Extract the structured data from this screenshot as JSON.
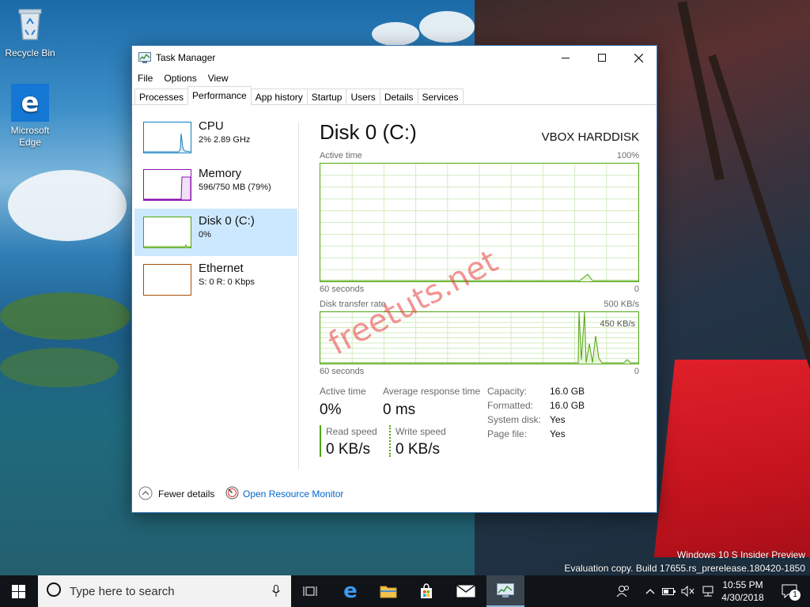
{
  "desktop": {
    "icons": [
      {
        "label": "Recycle Bin",
        "icon": "recycle-bin-icon"
      },
      {
        "label": "Microsoft Edge",
        "icon": "edge-icon"
      }
    ],
    "watermark_line1": "Windows 10 S Insider Preview",
    "watermark_line2": "Evaluation copy. Build 17655.rs_prerelease.180420-1850",
    "site_watermark": "freetuts.net"
  },
  "window": {
    "title": "Task Manager",
    "controls": {
      "minimize": "minimize-icon",
      "maximize": "maximize-icon",
      "close": "close-icon"
    },
    "menu": [
      "File",
      "Options",
      "View"
    ],
    "tabs": [
      "Processes",
      "Performance",
      "App history",
      "Startup",
      "Users",
      "Details",
      "Services"
    ],
    "active_tab": "Performance"
  },
  "sidebar": {
    "items": [
      {
        "name": "CPU",
        "sub": "2%  2.89 GHz",
        "color": "#117dbb"
      },
      {
        "name": "Memory",
        "sub": "596/750 MB (79%)",
        "color": "#8b12ae"
      },
      {
        "name": "Disk 0 (C:)",
        "sub": "0%",
        "color": "#4da60c",
        "selected": true
      },
      {
        "name": "Ethernet",
        "sub": "S: 0  R: 0 Kbps",
        "color": "#a74f01"
      }
    ]
  },
  "detail": {
    "title": "Disk 0 (C:)",
    "model": "VBOX HARDDISK",
    "graph1": {
      "label": "Active time",
      "max": "100%",
      "x_left": "60 seconds",
      "x_right": "0"
    },
    "graph2": {
      "label": "Disk transfer rate",
      "max": "500 KB/s",
      "inner": "450 KB/s",
      "x_left": "60 seconds",
      "x_right": "0"
    },
    "stats": {
      "active_time_label": "Active time",
      "active_time_value": "0%",
      "avg_resp_label": "Average response time",
      "avg_resp_value": "0 ms",
      "read_label": "Read speed",
      "read_value": "0 KB/s",
      "write_label": "Write speed",
      "write_value": "0 KB/s"
    },
    "props": [
      {
        "k": "Capacity:",
        "v": "16.0 GB"
      },
      {
        "k": "Formatted:",
        "v": "16.0 GB"
      },
      {
        "k": "System disk:",
        "v": "Yes"
      },
      {
        "k": "Page file:",
        "v": "Yes"
      }
    ],
    "colors": {
      "disk": "#4da60c",
      "grid": "#d3ecbf"
    }
  },
  "footer": {
    "fewer_details": "Fewer details",
    "open_resource_monitor": "Open Resource Monitor"
  },
  "taskbar": {
    "search_placeholder": "Type here to search",
    "clock_time": "10:55 PM",
    "clock_date": "4/30/2018",
    "notification_count": "1",
    "icons": [
      "windows-start-icon",
      "cortana-circle-icon",
      "microphone-icon",
      "task-view-icon",
      "edge-icon",
      "file-explorer-icon",
      "store-icon",
      "mail-icon",
      "task-manager-icon"
    ]
  }
}
